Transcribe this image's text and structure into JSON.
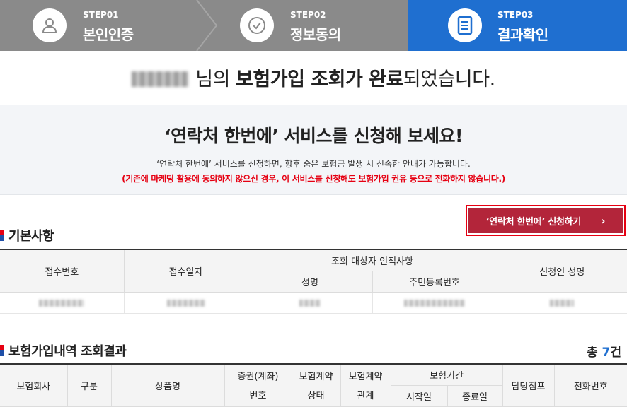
{
  "steps": [
    {
      "num": "STEP01",
      "name": "본인인증",
      "icon": "person-icon"
    },
    {
      "num": "STEP02",
      "name": "정보동의",
      "icon": "check-circle-icon"
    },
    {
      "num": "STEP03",
      "name": "결과확인",
      "icon": "document-icon",
      "active": true
    }
  ],
  "result_title": {
    "suffix_1": "님의 ",
    "bold": "보험가입 조회가 완료",
    "suffix_2": "되었습니다."
  },
  "promo": {
    "headline": "‘연락처 한번에’ 서비스를 신청해 보세요!",
    "description": "‘연락처 한번에’ 서비스를 신청하면, 향후 숨은 보험금 발생 시 신속한 안내가 가능합니다.",
    "warning": "(기존에 마케팅 활용에 동의하지 않으신 경우, 이 서비스를 신청해도 보험가입 권유 등으로 전화하지 않습니다.)"
  },
  "apply_button": {
    "label": "‘연락처 한번에’ 신청하기",
    "chevron": "›"
  },
  "basic_info": {
    "title": "기본사항",
    "headers": {
      "receipt_no": "접수번호",
      "receipt_date": "접수일자",
      "subject_group": "조회 대상자 인적사항",
      "name": "성명",
      "rrn": "주민등록번호",
      "applicant_name": "신청인 성명"
    }
  },
  "results": {
    "title": "보험가입내역 조회결과",
    "count_prefix": "총 ",
    "count": "7",
    "count_suffix": "건",
    "headers": {
      "company": "보험회사",
      "type": "구분",
      "product": "상품명",
      "policy_no_1": "증권(계좌)",
      "policy_no_2": "번호",
      "status_1": "보험계약",
      "status_2": "상태",
      "relation_1": "보험계약",
      "relation_2": "관계",
      "period": "보험기간",
      "start": "시작일",
      "end": "종료일",
      "branch": "담당점포",
      "phone": "전화번호"
    }
  },
  "colors": {
    "active_step": "#1f6fd0",
    "inactive_step": "#8a8a8a",
    "accent_red": "#e60012",
    "button_bg": "#b3253a"
  }
}
